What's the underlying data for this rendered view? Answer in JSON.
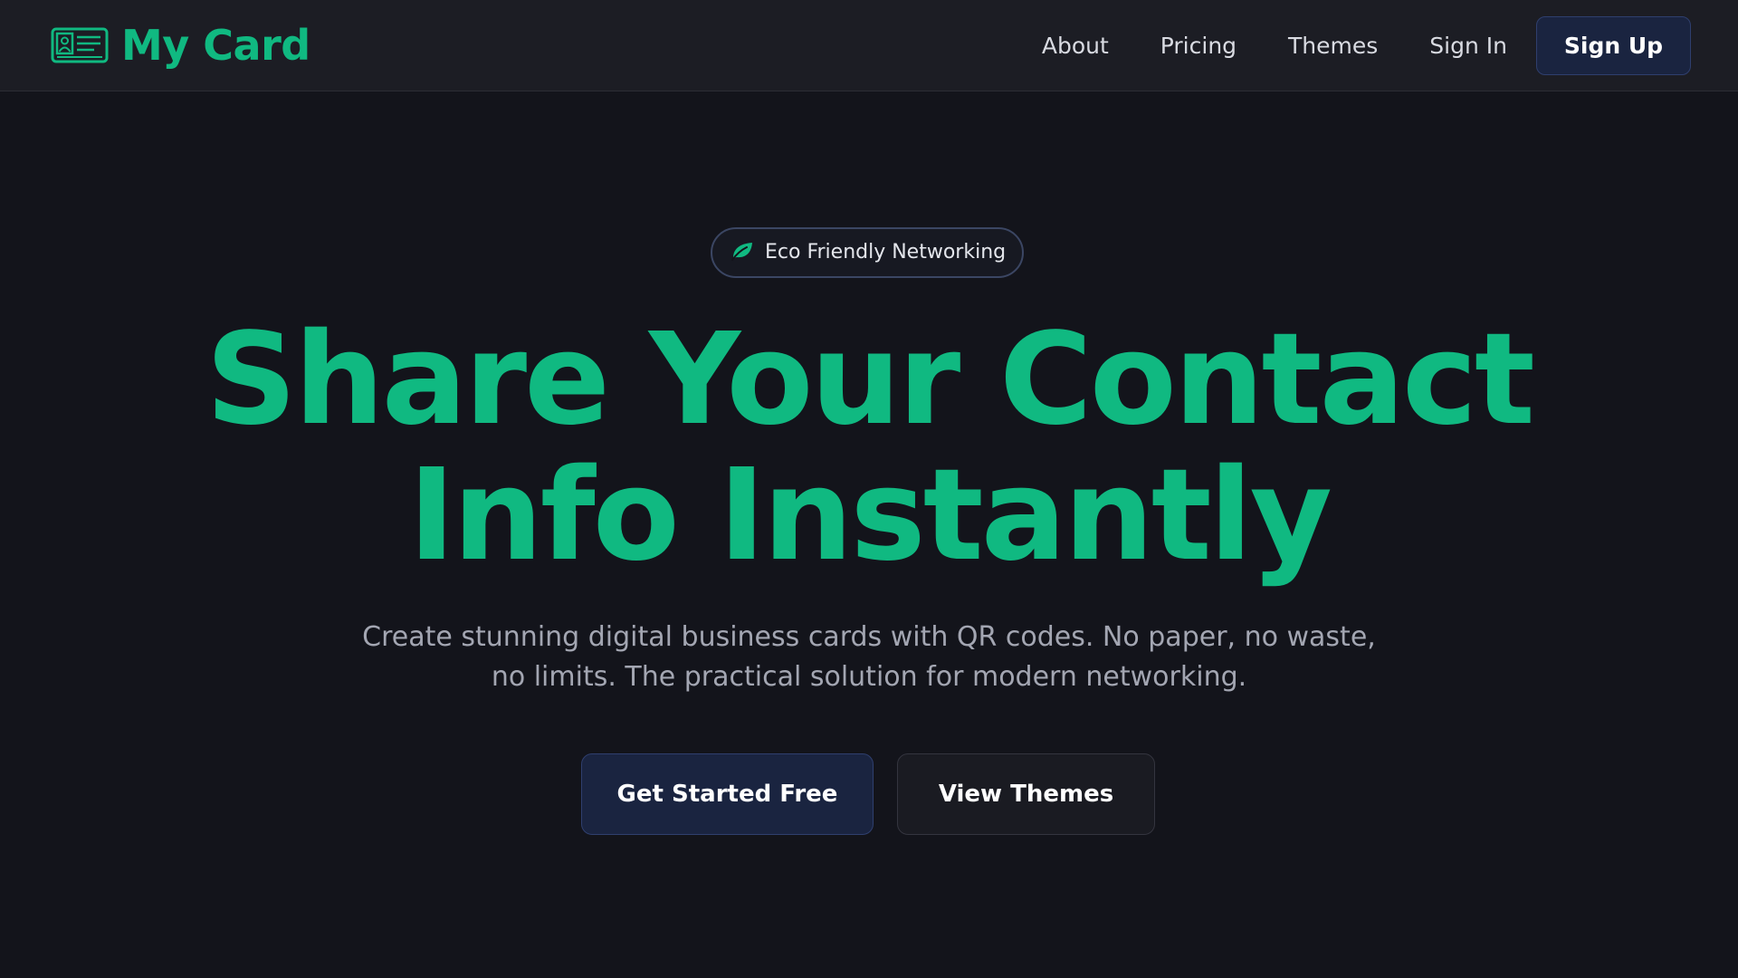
{
  "colors": {
    "background": "#13141b",
    "header_background": "#1c1d24",
    "accent": "#10b981",
    "button_primary": "#1a2440"
  },
  "brand": {
    "icon": "id-card-icon",
    "name": "My Card"
  },
  "nav": {
    "items": [
      {
        "label": "About"
      },
      {
        "label": "Pricing"
      },
      {
        "label": "Themes"
      },
      {
        "label": "Sign In"
      }
    ],
    "signup_label": "Sign Up"
  },
  "hero": {
    "badge": {
      "icon": "leaf-icon",
      "text": "Eco Friendly Networking"
    },
    "title_line1": "Share Your Contact",
    "title_line2": "Info Instantly",
    "subtitle": "Create stunning digital business cards with QR codes. No paper, no waste, no limits. The practical solution for modern networking.",
    "primary_cta": "Get Started Free",
    "secondary_cta": "View Themes"
  }
}
